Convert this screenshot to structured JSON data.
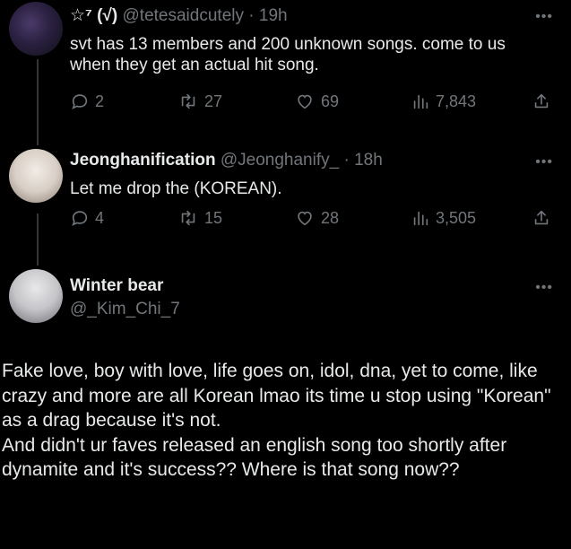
{
  "tweets": [
    {
      "name": "☆⁷ (√)",
      "handle": "@tetesaidcutely",
      "time": "19h",
      "text": "svt has 13 members and 200 unknown songs. come to us when they get an actual hit song.",
      "replies": "2",
      "retweets": "27",
      "likes": "69",
      "views": "7,843"
    },
    {
      "name": "Jeonghanification",
      "handle": "@Jeonghanify_",
      "time": "18h",
      "text": "Let me drop the (KOREAN).",
      "replies": "4",
      "retweets": "15",
      "likes": "28",
      "views": "3,505"
    },
    {
      "name": "Winter bear",
      "handle": "@_Kim_Chi_7",
      "text": "Fake love, boy with love, life goes on, idol, dna, yet to come, like crazy and more are all Korean lmao its time u stop using \"Korean\" as a drag because it's not.\nAnd didn't ur faves released an english song too shortly after dynamite and it's success?? Where is that song now??"
    }
  ],
  "ui": {
    "dot": "·",
    "more": "•••"
  },
  "icons": [
    "reply-icon",
    "retweet-icon",
    "like-icon",
    "views-icon",
    "share-icon",
    "more-icon"
  ]
}
